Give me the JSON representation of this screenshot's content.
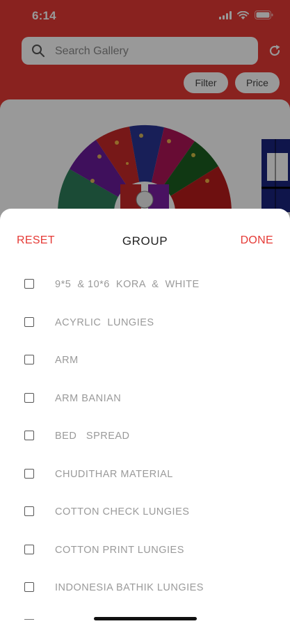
{
  "status_bar": {
    "time": "6:14"
  },
  "search": {
    "placeholder": "Search Gallery"
  },
  "chips": {
    "filter_label": "Filter",
    "price_label": "Price"
  },
  "sheet": {
    "reset_label": "RESET",
    "title": "GROUP",
    "done_label": "DONE",
    "items": [
      {
        "label": "9*5  & 10*6  KORA  &  WHITE",
        "checked": false
      },
      {
        "label": "ACYRLIC  LUNGIES",
        "checked": false
      },
      {
        "label": "ARM",
        "checked": false
      },
      {
        "label": "ARM BANIAN",
        "checked": false
      },
      {
        "label": "BED   SPREAD",
        "checked": false
      },
      {
        "label": "CHUDITHAR MATERIAL",
        "checked": false
      },
      {
        "label": "COTTON CHECK LUNGIES",
        "checked": false
      },
      {
        "label": "COTTON PRINT LUNGIES",
        "checked": false
      },
      {
        "label": "INDONESIA BATHIK LUNGIES",
        "checked": false
      }
    ]
  },
  "colors": {
    "accent": "#e53935",
    "header_bg": "#e53935",
    "item_text": "#9a9a9a",
    "title_text": "#222222"
  },
  "icons": {
    "search": "search-icon",
    "refresh": "refresh-icon",
    "signal": "signal-icon",
    "wifi": "wifi-icon",
    "battery": "battery-icon"
  }
}
